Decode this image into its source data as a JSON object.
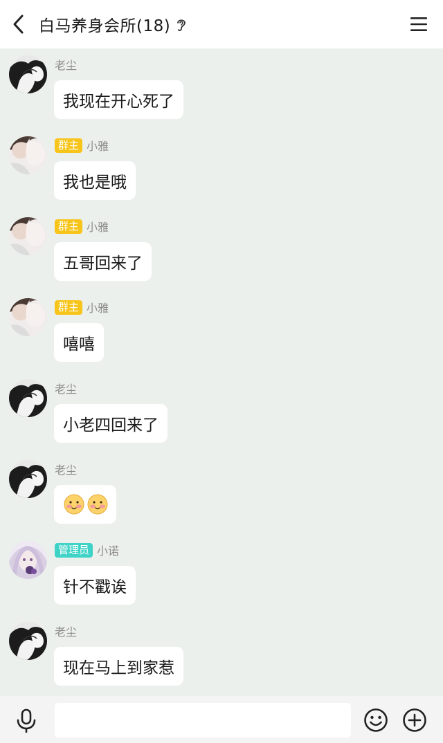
{
  "header": {
    "title": "白马养身会所(18)",
    "back_icon": "chevron-left-icon",
    "ear_icon": "ear-icon",
    "menu_icon": "hamburger-menu-icon"
  },
  "messages": [
    {
      "sender": "老尘",
      "badge": "",
      "avatar": "bw-anime-couple",
      "text": "我现在开心死了"
    },
    {
      "sender": "小雅",
      "badge": "群主",
      "avatar": "photo-couple",
      "text": "我也是哦"
    },
    {
      "sender": "小雅",
      "badge": "群主",
      "avatar": "photo-couple",
      "text": "五哥回来了"
    },
    {
      "sender": "小雅",
      "badge": "群主",
      "avatar": "photo-couple",
      "text": "嘻嘻"
    },
    {
      "sender": "老尘",
      "badge": "",
      "avatar": "bw-anime-couple",
      "text": "小老四回来了"
    },
    {
      "sender": "老尘",
      "badge": "",
      "avatar": "bw-anime-couple",
      "text": "",
      "emojis": [
        "blush-emoji",
        "blush-emoji"
      ]
    },
    {
      "sender": "小诺",
      "badge": "管理员",
      "avatar": "purple-anime-girl",
      "text": "针不戳诶"
    },
    {
      "sender": "老尘",
      "badge": "",
      "avatar": "bw-anime-couple",
      "text": "现在马上到家惹"
    }
  ],
  "input_bar": {
    "voice_icon": "microphone-icon",
    "input_value": "",
    "emoji_icon": "smiley-icon",
    "plus_icon": "plus-circle-icon"
  },
  "colors": {
    "chat_background": "#ecf0ec",
    "owner_badge": "#f7c41a",
    "admin_badge": "#3fd2c6",
    "bubble": "#ffffff"
  }
}
